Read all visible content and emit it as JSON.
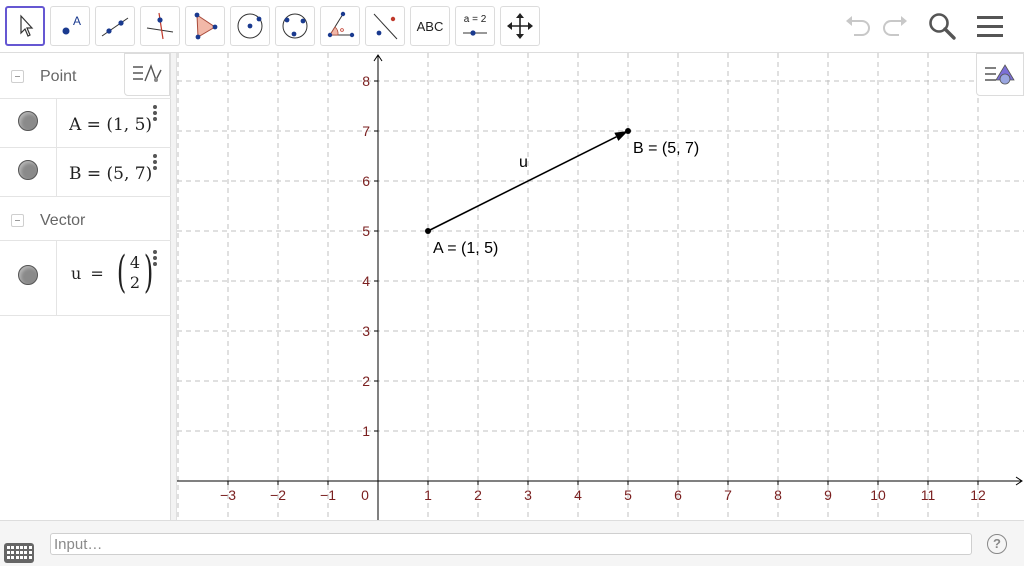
{
  "toolbar": {
    "tools": [
      {
        "name": "move-tool",
        "icon": "arrow-pointer-icon",
        "selected": true
      },
      {
        "name": "point-tool",
        "icon": "point-icon",
        "label": "A"
      },
      {
        "name": "line-tool",
        "icon": "line-icon"
      },
      {
        "name": "perpendicular-line-tool",
        "icon": "perpendicular-icon"
      },
      {
        "name": "polygon-tool",
        "icon": "polygon-icon"
      },
      {
        "name": "circle-tool",
        "icon": "circle-center-point-icon"
      },
      {
        "name": "circle-three-points-tool",
        "icon": "circle-three-points-icon"
      },
      {
        "name": "angle-tool",
        "icon": "angle-icon"
      },
      {
        "name": "reflect-tool",
        "icon": "reflect-line-icon"
      },
      {
        "name": "text-tool",
        "icon": "text-icon",
        "label": "ABC"
      },
      {
        "name": "slider-tool",
        "icon": "slider-icon",
        "label": "a = 2"
      },
      {
        "name": "move-graphics-tool",
        "icon": "move-arrows-icon"
      }
    ],
    "right": {
      "undo": "undo-icon",
      "redo": "redo-icon",
      "search": "search-icon",
      "menu": "menu-icon"
    }
  },
  "algebra": {
    "groups": [
      {
        "title": "Point",
        "items": [
          {
            "label": "A",
            "formula": "A = (1, 5)"
          },
          {
            "label": "B",
            "formula": "B = (5, 7)"
          }
        ]
      },
      {
        "title": "Vector",
        "items": [
          {
            "label": "u",
            "name": "u",
            "eq": "=",
            "components": [
              "4",
              "2"
            ]
          }
        ]
      }
    ]
  },
  "graphics": {
    "x_ticks": [
      "−3",
      "−2",
      "−1",
      "0",
      "1",
      "2",
      "3",
      "4",
      "5",
      "6",
      "7",
      "8",
      "9",
      "10",
      "11",
      "12"
    ],
    "y_ticks": [
      "1",
      "2",
      "3",
      "4",
      "5",
      "6",
      "7",
      "8"
    ],
    "points": [
      {
        "name": "A",
        "x": 1,
        "y": 5,
        "label": "A = (1, 5)"
      },
      {
        "name": "B",
        "x": 5,
        "y": 7,
        "label": "B = (5, 7)"
      }
    ],
    "vector": {
      "name": "u",
      "from": [
        1,
        5
      ],
      "to": [
        5,
        7
      ],
      "label": "u"
    },
    "axis_color": "#000000",
    "tick_label_color": "#7a1f1f",
    "grid_color": "#c0c0c0"
  },
  "input": {
    "placeholder": "Input…",
    "help": "?"
  },
  "colors": {
    "accent": "#6557d2",
    "point_fill": "#8a8a8a"
  }
}
